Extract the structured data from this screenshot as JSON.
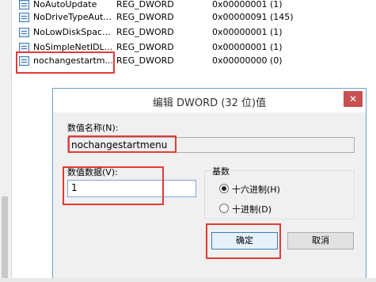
{
  "registry": {
    "rows": [
      {
        "name": "NoAutoUpdate",
        "type": "REG_DWORD",
        "data": "0x00000001 (1)"
      },
      {
        "name": "NoDriveTypeAut...",
        "type": "REG_DWORD",
        "data": "0x00000091 (145)"
      },
      {
        "name": "NoLowDiskSpac...",
        "type": "REG_DWORD",
        "data": "0x00000001 (1)"
      },
      {
        "name": "NoSimpleNetIDL...",
        "type": "REG_DWORD",
        "data": "0x00000001 (1)"
      },
      {
        "name": "nochangestartm...",
        "type": "REG_DWORD",
        "data": "0x00000000 (0)"
      }
    ]
  },
  "dialog": {
    "title": "编辑 DWORD (32 位)值",
    "close_label": "✕",
    "value_name_label": "数值名称(N):",
    "value_name": "nochangestartmenu",
    "value_data_label": "数值数据(V):",
    "value_data": "1",
    "base_label": "基数",
    "radio_hex": "十六进制(H)",
    "radio_dec": "十进制(D)",
    "ok_label": "确定",
    "cancel_label": "取消"
  }
}
